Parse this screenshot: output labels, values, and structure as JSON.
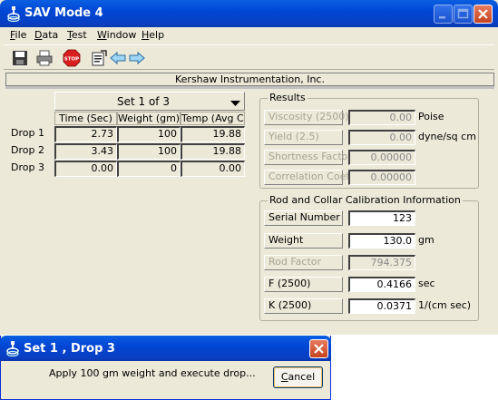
{
  "window": {
    "title": "SAV Mode 4"
  },
  "menu": [
    {
      "label": "File",
      "hotkey": "F",
      "rest": "ile"
    },
    {
      "label": "Data",
      "hotkey": "D",
      "rest": "ata"
    },
    {
      "label": "Test",
      "hotkey": "T",
      "rest": "est"
    },
    {
      "label": "Window",
      "hotkey": "W",
      "rest": "indow"
    },
    {
      "label": "Help",
      "hotkey": "H",
      "rest": "elp"
    }
  ],
  "toolbar": {
    "icons": [
      "save-icon",
      "print-icon",
      "stop-icon",
      "properties-icon",
      "back-arrow-icon",
      "forward-arrow-icon"
    ],
    "stop_label": "STOP"
  },
  "banner": "Kershaw Instrumentation, Inc.",
  "set_selector": {
    "value": "Set 1 of 3"
  },
  "drops_table": {
    "columns": [
      "Time (Sec)",
      "Weight (gm)",
      "Temp (Avg C)"
    ],
    "rows": [
      {
        "label": "Drop 1",
        "time": "2.73",
        "weight": "100",
        "temp": "19.88"
      },
      {
        "label": "Drop 2",
        "time": "3.43",
        "weight": "100",
        "temp": "19.88"
      },
      {
        "label": "Drop 3",
        "time": "0.00",
        "weight": "0",
        "temp": "0.00"
      }
    ]
  },
  "results": {
    "title": "Results",
    "viscosity": {
      "label": "Viscosity (2500)",
      "value": "0.00",
      "unit": "Poise"
    },
    "yield": {
      "label": "Yield (2.5)",
      "value": "0.00",
      "unit": "dyne/sq cm"
    },
    "shortness": {
      "label": "Shortness Factor",
      "value": "0.00000"
    },
    "correlation": {
      "label": "Correlation Coeff",
      "value": "0.00000"
    }
  },
  "calibration": {
    "title": "Rod and Collar Calibration Information",
    "serial": {
      "label": "Serial Number",
      "value": "123"
    },
    "weight": {
      "label": "Weight",
      "value": "130.0",
      "unit": "gm"
    },
    "rod_factor": {
      "label": "Rod Factor",
      "value": "794.375"
    },
    "f": {
      "label": "F (2500)",
      "value": "0.4166",
      "unit": "sec"
    },
    "k": {
      "label": "K (2500)",
      "value": "0.0371",
      "unit": "1/(cm sec)"
    }
  },
  "dialog": {
    "title": "Set 1 , Drop 3",
    "message": "Apply  100 gm weight and execute drop...",
    "cancel_hotkey": "C",
    "cancel_rest": "ancel"
  },
  "colors": {
    "titlebar": "#0046d6",
    "window_face": "#ece9d8",
    "close": "#c4431f"
  }
}
